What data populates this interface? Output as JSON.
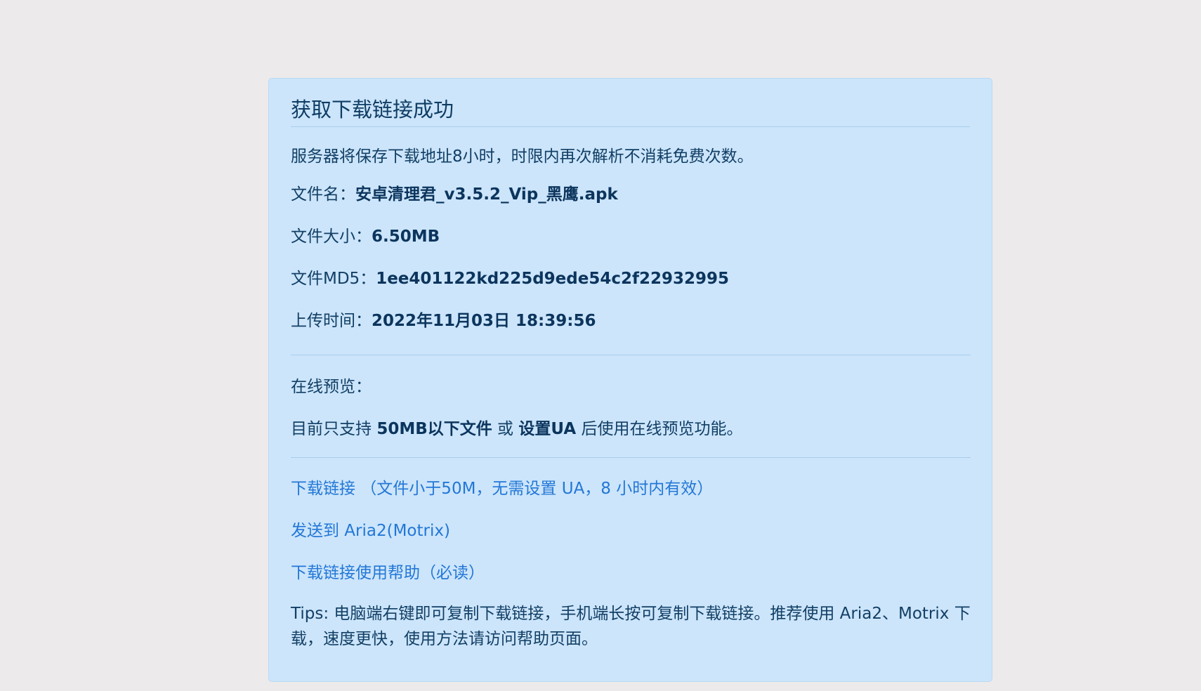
{
  "card": {
    "title": "获取下载链接成功",
    "notice": "服务器将保存下载地址8小时，时限内再次解析不消耗免费次数。",
    "file_name_label": "文件名：",
    "file_name_value": "安卓清理君_v3.5.2_Vip_黑鹰.apk",
    "file_size_label": "文件大小：",
    "file_size_value": "6.50MB",
    "file_md5_label": "文件MD5：",
    "file_md5_value": "1ee401122kd225d9ede54c2f22932995",
    "upload_time_label": "上传时间：",
    "upload_time_value": "2022年11月03日 18:39:56",
    "online_preview_label": "在线预览：",
    "preview_text_1": "目前只支持 ",
    "preview_strong_1": "50MB以下文件",
    "preview_text_2": " 或 ",
    "preview_strong_2": "设置UA",
    "preview_text_3": " 后使用在线预览功能。",
    "download_link": "下载链接 （文件小于50M，无需设置 UA，8 小时内有效）",
    "aria2_link": "发送到 Aria2(Motrix)",
    "help_link": "下载链接使用帮助（必读）",
    "tips": "Tips: 电脑端右键即可复制下载链接，手机端长按可复制下载链接。推荐使用 Aria2、Motrix 下载，速度更快，使用方法请访问帮助页面。"
  }
}
